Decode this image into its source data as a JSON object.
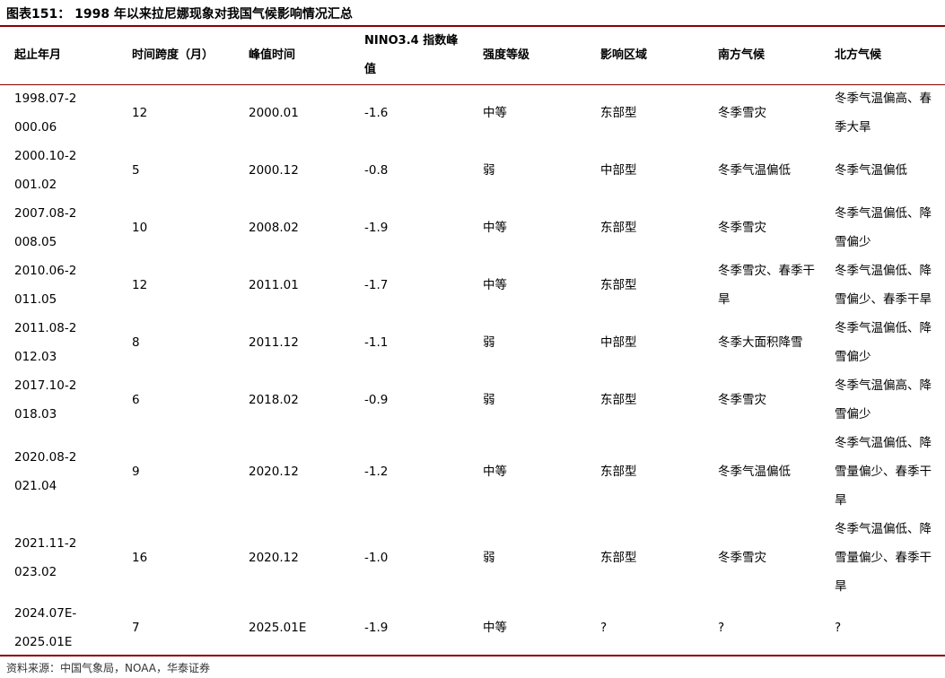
{
  "title": "图表151： 1998 年以来拉尼娜现象对我国气候影响情况汇总",
  "headers": [
    "起止年月",
    "时间跨度（月）",
    "峰值时间",
    "NINO3.4 指数峰值",
    "强度等级",
    "影响区域",
    "南方气候",
    "北方气候"
  ],
  "rows": [
    [
      "1998.07-2000.06",
      "12",
      "2000.01",
      "-1.6",
      "中等",
      "东部型",
      "冬季雪灾",
      "冬季气温偏高、春季大旱"
    ],
    [
      "2000.10-2001.02",
      "5",
      "2000.12",
      "-0.8",
      "弱",
      "中部型",
      "冬季气温偏低",
      "冬季气温偏低"
    ],
    [
      "2007.08-2008.05",
      "10",
      "2008.02",
      "-1.9",
      "中等",
      "东部型",
      "冬季雪灾",
      "冬季气温偏低、降雪偏少"
    ],
    [
      "2010.06-2011.05",
      "12",
      "2011.01",
      "-1.7",
      "中等",
      "东部型",
      "冬季雪灾、春季干旱",
      "冬季气温偏低、降雪偏少、春季干旱"
    ],
    [
      "2011.08-2012.03",
      "8",
      "2011.12",
      "-1.1",
      "弱",
      "中部型",
      "冬季大面积降雪",
      "冬季气温偏低、降雪偏少"
    ],
    [
      "2017.10-2018.03",
      "6",
      "2018.02",
      "-0.9",
      "弱",
      "东部型",
      "冬季雪灾",
      "冬季气温偏高、降雪偏少"
    ],
    [
      "2020.08-2021.04",
      "9",
      "2020.12",
      "-1.2",
      "中等",
      "东部型",
      "冬季气温偏低",
      "冬季气温偏低、降雪量偏少、春季干旱"
    ],
    [
      "2021.11-2023.02",
      "16",
      "2020.12",
      "-1.0",
      "弱",
      "东部型",
      "冬季雪灾",
      "冬季气温偏低、降雪量偏少、春季干旱"
    ],
    [
      "2024.07E-2025.01E",
      "7",
      "2025.01E",
      "-1.9",
      "中等",
      "?",
      "?",
      "?"
    ]
  ],
  "source": "资料来源：中国气象局，NOAA，华泰证券"
}
